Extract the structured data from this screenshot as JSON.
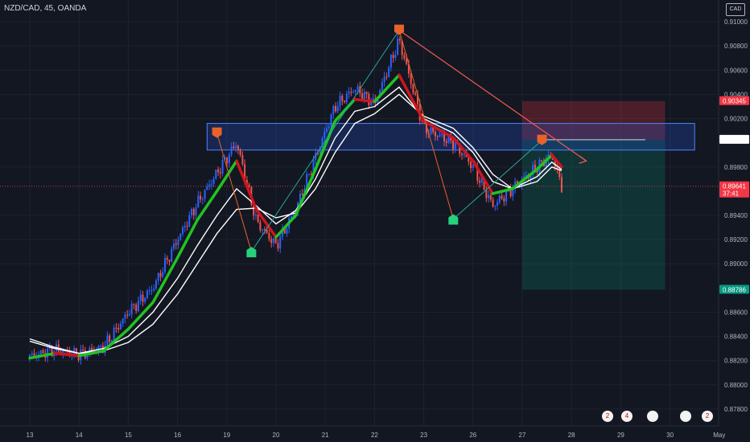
{
  "header": {
    "symbol": "NZD/CAD, 45, OANDA",
    "currency": "CAD"
  },
  "colors": {
    "background": "#131722",
    "bull": "#2962ff",
    "bear": "#ef5350",
    "ma_up": "#22c322",
    "ma_down": "#d0141d",
    "ma_white": "#ffffff",
    "zone": "#2962ff",
    "pattern": "#e8622a",
    "pattern_green": "#26a69a",
    "sl_zone": "#f23645",
    "tp_zone": "#089981"
  },
  "chart_data": {
    "type": "line",
    "title": "NZD/CAD, 45, OANDA",
    "x_tick_labels": [
      "13",
      "14",
      "15",
      "16",
      "19",
      "20",
      "21",
      "22",
      "23",
      "26",
      "27",
      "28",
      "29",
      "30",
      "May"
    ],
    "y_tick_labels": [
      "0.91000",
      "0.90800",
      "0.90600",
      "0.90400",
      "0.90200",
      "0.89800",
      "0.89400",
      "0.89200",
      "0.89000",
      "0.88600",
      "0.88400",
      "0.88200",
      "0.88000",
      "0.87800"
    ],
    "ylim": [
      0.8766,
      0.9118
    ],
    "series": [
      {
        "kind": "price",
        "x": [
          0.0,
          0.5,
          1.0,
          1.5,
          2.0,
          2.5,
          3.0,
          3.4,
          3.8,
          4.2,
          4.6,
          5.0,
          5.4,
          5.8,
          6.2,
          6.6,
          7.0,
          7.5,
          8.0,
          8.6,
          9.0,
          9.4,
          9.8,
          10.3,
          10.6,
          10.8
        ],
        "values": [
          0.8823,
          0.8829,
          0.8825,
          0.8831,
          0.886,
          0.888,
          0.892,
          0.895,
          0.8975,
          0.9,
          0.8935,
          0.8915,
          0.8945,
          0.8988,
          0.903,
          0.9045,
          0.9032,
          0.9085,
          0.9012,
          0.9,
          0.898,
          0.8948,
          0.8962,
          0.898,
          0.899,
          0.8964
        ]
      },
      {
        "kind": "ma_fast",
        "x": [
          0.0,
          0.5,
          1.0,
          1.5,
          2.0,
          2.5,
          3.0,
          3.4,
          3.8,
          4.2,
          4.6,
          5.0,
          5.4,
          5.8,
          6.2,
          6.6,
          7.0,
          7.5,
          8.0,
          8.6,
          9.0,
          9.4,
          9.8,
          10.3,
          10.6,
          10.8
        ],
        "values": [
          0.8822,
          0.8826,
          0.8824,
          0.8828,
          0.8846,
          0.8868,
          0.8905,
          0.8936,
          0.896,
          0.8985,
          0.8945,
          0.8922,
          0.894,
          0.8978,
          0.9018,
          0.9036,
          0.9034,
          0.9056,
          0.9018,
          0.9004,
          0.8985,
          0.8958,
          0.8962,
          0.8978,
          0.899,
          0.898
        ]
      },
      {
        "kind": "ma_slow_1",
        "x": [
          0.0,
          0.5,
          1.0,
          1.5,
          2.0,
          2.5,
          3.0,
          3.4,
          3.8,
          4.2,
          4.6,
          5.0,
          5.4,
          5.8,
          6.2,
          6.6,
          7.0,
          7.5,
          8.0,
          8.6,
          9.0,
          9.4,
          9.8,
          10.3,
          10.6,
          10.8
        ],
        "values": [
          0.8836,
          0.883,
          0.8826,
          0.883,
          0.884,
          0.886,
          0.8888,
          0.8915,
          0.894,
          0.8962,
          0.8948,
          0.8933,
          0.8944,
          0.897,
          0.9004,
          0.9026,
          0.903,
          0.9046,
          0.902,
          0.9008,
          0.8992,
          0.8968,
          0.8962,
          0.8972,
          0.8984,
          0.8978
        ]
      },
      {
        "kind": "ma_slow_2",
        "x": [
          0.0,
          0.5,
          1.0,
          1.5,
          2.0,
          2.5,
          3.0,
          3.4,
          3.8,
          4.2,
          4.6,
          5.0,
          5.4,
          5.8,
          6.2,
          6.6,
          7.0,
          7.5,
          8.0,
          8.6,
          9.0,
          9.4,
          9.8,
          10.3,
          10.6,
          10.8
        ],
        "values": [
          0.8838,
          0.8831,
          0.8826,
          0.8828,
          0.8835,
          0.885,
          0.8875,
          0.89,
          0.8925,
          0.8945,
          0.8946,
          0.8938,
          0.8942,
          0.8962,
          0.8992,
          0.9016,
          0.9024,
          0.904,
          0.9022,
          0.9012,
          0.8996,
          0.8974,
          0.8962,
          0.8968,
          0.898,
          0.8977
        ]
      }
    ],
    "annotations": {
      "resistance_zone": {
        "y_top": 0.9016,
        "y_bottom": 0.8994,
        "x_start": 3.6,
        "x_end": 13.5
      },
      "price_tags": [
        {
          "label": "0.90345",
          "value": 0.90345,
          "color": "#f23645"
        },
        {
          "label": "0.90025",
          "value": 0.90025,
          "color": "#ffffff"
        },
        {
          "label": "0.89641",
          "value": 0.89641,
          "color": "#f23645",
          "sub": "37:41"
        },
        {
          "label": "0.88786",
          "value": 0.88786,
          "color": "#089981"
        }
      ],
      "position": {
        "x_start": 10.0,
        "x_end": 12.9,
        "stop": 0.90345,
        "entry": 0.90025,
        "target": 0.88786
      },
      "pattern_points": [
        {
          "x": 3.8,
          "y": 0.9008,
          "color": "#e8622a",
          "dir": "down"
        },
        {
          "x": 4.5,
          "y": 0.891,
          "color": "#26d17c",
          "dir": "up"
        },
        {
          "x": 7.5,
          "y": 0.9093,
          "color": "#e8622a",
          "dir": "down"
        },
        {
          "x": 8.6,
          "y": 0.8937,
          "color": "#26d17c",
          "dir": "up"
        },
        {
          "x": 10.4,
          "y": 0.9002,
          "color": "#e8622a",
          "dir": "down"
        }
      ],
      "projection": {
        "x1": 7.5,
        "y1": 0.9093,
        "x2": 11.3,
        "y2": 0.8985
      }
    }
  },
  "events": [
    {
      "icon": "nz-flag-icon",
      "label": "2"
    },
    {
      "icon": "calendar-icon",
      "label": "4"
    },
    {
      "icon": "ca-flag-icon",
      "label": ""
    },
    {
      "icon": "globe-icon",
      "label": ""
    },
    {
      "icon": "nz-flag-icon",
      "label": "2"
    }
  ]
}
